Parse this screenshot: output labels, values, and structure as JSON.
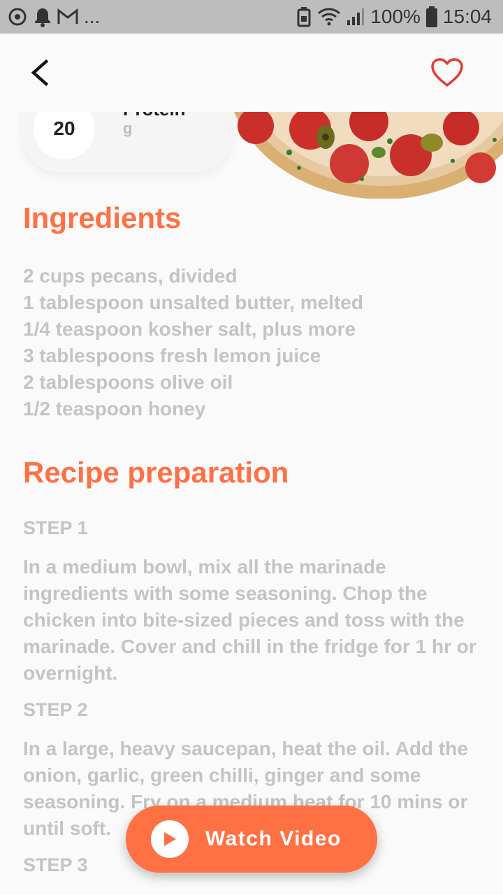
{
  "status_bar": {
    "dots": "...",
    "battery": "100%",
    "time": "15:04"
  },
  "nutrient": {
    "value": "20",
    "name": "Protein",
    "unit": "g"
  },
  "ingredients": {
    "title": "Ingredients",
    "items": [
      "2 cups pecans, divided",
      "1 tablespoon unsalted butter, melted",
      "1/4 teaspoon kosher salt, plus more",
      "3 tablespoons fresh lemon juice",
      "2 tablespoons olive oil",
      "1/2 teaspoon honey"
    ]
  },
  "preparation": {
    "title": "Recipe preparation",
    "steps": [
      {
        "label": "STEP 1",
        "text": "In a medium bowl, mix all the marinade ingredients with some seasoning. Chop the chicken into bite-sized pieces and toss with the marinade. Cover and chill in the fridge for 1 hr or overnight."
      },
      {
        "label": "STEP 2",
        "text": "In a large, heavy saucepan, heat the oil. Add the onion, garlic, green chilli, ginger and some seasoning. Fry on a medium heat for 10 mins or until soft."
      },
      {
        "label": "STEP 3",
        "text": ""
      }
    ]
  },
  "watch_button": {
    "label": "Watch Video"
  },
  "colors": {
    "accent": "#ff7043",
    "muted_text": "#c4c4c4",
    "status_bar": "#bdbdbd",
    "heart": "#e53935"
  },
  "icons": {
    "back": "back-arrow-icon",
    "favorite": "heart-outline-icon",
    "play": "play-icon"
  }
}
